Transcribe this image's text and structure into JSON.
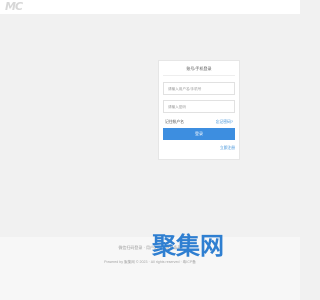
{
  "header": {
    "logo_text": "MC"
  },
  "login": {
    "title": "账号/手机登录",
    "username_placeholder": "请输入用户名/手机号",
    "password_placeholder": "请输入密码",
    "remember_label": "记住帐户名",
    "forgot_link": "忘记密码?",
    "submit_label": "登录",
    "register_link": "立即注册"
  },
  "footer": {
    "line1": "微信扫码登录 · 用户协议 · 隐私条款",
    "line2": "Powered by 聚集网 © 2023 · All rights reserved · 粤ICP备"
  },
  "watermark": {
    "text": "聚集网"
  },
  "colors": {
    "accent": "#3d8ee0",
    "link": "#3b8fd8",
    "watermark": "#2f7fd1"
  }
}
